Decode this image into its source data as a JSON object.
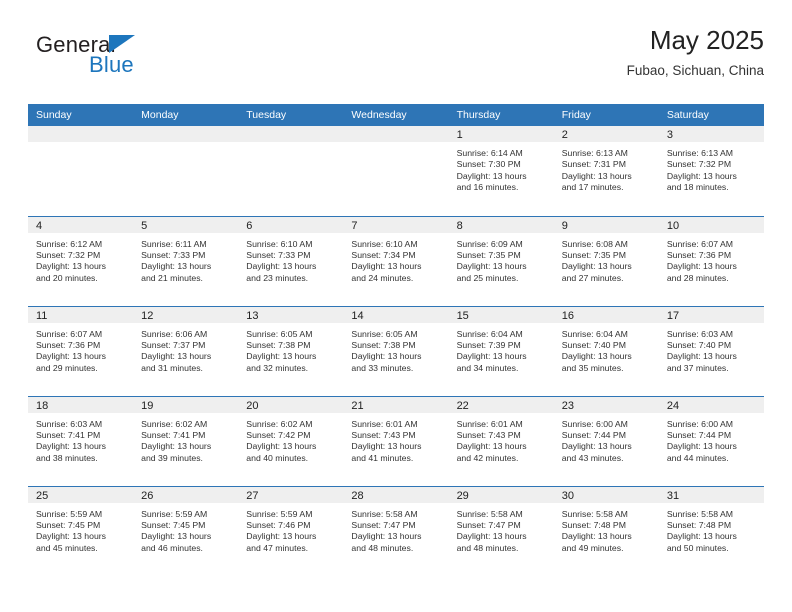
{
  "logo": {
    "word_top": "General",
    "word_bottom": "Blue",
    "flag_icon": "triangle-flag-icon",
    "color_blue": "#1d76bd",
    "color_dark": "#231f20"
  },
  "header": {
    "title": "May 2025",
    "subtitle": "Fubao, Sichuan, China"
  },
  "theme": {
    "header_blue": "#2e75b6",
    "date_strip_gray": "#efefef",
    "row_divider": "#2e75b6"
  },
  "weekdays": [
    "Sunday",
    "Monday",
    "Tuesday",
    "Wednesday",
    "Thursday",
    "Friday",
    "Saturday"
  ],
  "weeks": [
    [
      {
        "date": "",
        "lines": []
      },
      {
        "date": "",
        "lines": []
      },
      {
        "date": "",
        "lines": []
      },
      {
        "date": "",
        "lines": []
      },
      {
        "date": "1",
        "lines": [
          "Sunrise: 6:14 AM",
          "Sunset: 7:30 PM",
          "Daylight: 13 hours",
          "and 16 minutes."
        ]
      },
      {
        "date": "2",
        "lines": [
          "Sunrise: 6:13 AM",
          "Sunset: 7:31 PM",
          "Daylight: 13 hours",
          "and 17 minutes."
        ]
      },
      {
        "date": "3",
        "lines": [
          "Sunrise: 6:13 AM",
          "Sunset: 7:32 PM",
          "Daylight: 13 hours",
          "and 18 minutes."
        ]
      }
    ],
    [
      {
        "date": "4",
        "lines": [
          "Sunrise: 6:12 AM",
          "Sunset: 7:32 PM",
          "Daylight: 13 hours",
          "and 20 minutes."
        ]
      },
      {
        "date": "5",
        "lines": [
          "Sunrise: 6:11 AM",
          "Sunset: 7:33 PM",
          "Daylight: 13 hours",
          "and 21 minutes."
        ]
      },
      {
        "date": "6",
        "lines": [
          "Sunrise: 6:10 AM",
          "Sunset: 7:33 PM",
          "Daylight: 13 hours",
          "and 23 minutes."
        ]
      },
      {
        "date": "7",
        "lines": [
          "Sunrise: 6:10 AM",
          "Sunset: 7:34 PM",
          "Daylight: 13 hours",
          "and 24 minutes."
        ]
      },
      {
        "date": "8",
        "lines": [
          "Sunrise: 6:09 AM",
          "Sunset: 7:35 PM",
          "Daylight: 13 hours",
          "and 25 minutes."
        ]
      },
      {
        "date": "9",
        "lines": [
          "Sunrise: 6:08 AM",
          "Sunset: 7:35 PM",
          "Daylight: 13 hours",
          "and 27 minutes."
        ]
      },
      {
        "date": "10",
        "lines": [
          "Sunrise: 6:07 AM",
          "Sunset: 7:36 PM",
          "Daylight: 13 hours",
          "and 28 minutes."
        ]
      }
    ],
    [
      {
        "date": "11",
        "lines": [
          "Sunrise: 6:07 AM",
          "Sunset: 7:36 PM",
          "Daylight: 13 hours",
          "and 29 minutes."
        ]
      },
      {
        "date": "12",
        "lines": [
          "Sunrise: 6:06 AM",
          "Sunset: 7:37 PM",
          "Daylight: 13 hours",
          "and 31 minutes."
        ]
      },
      {
        "date": "13",
        "lines": [
          "Sunrise: 6:05 AM",
          "Sunset: 7:38 PM",
          "Daylight: 13 hours",
          "and 32 minutes."
        ]
      },
      {
        "date": "14",
        "lines": [
          "Sunrise: 6:05 AM",
          "Sunset: 7:38 PM",
          "Daylight: 13 hours",
          "and 33 minutes."
        ]
      },
      {
        "date": "15",
        "lines": [
          "Sunrise: 6:04 AM",
          "Sunset: 7:39 PM",
          "Daylight: 13 hours",
          "and 34 minutes."
        ]
      },
      {
        "date": "16",
        "lines": [
          "Sunrise: 6:04 AM",
          "Sunset: 7:40 PM",
          "Daylight: 13 hours",
          "and 35 minutes."
        ]
      },
      {
        "date": "17",
        "lines": [
          "Sunrise: 6:03 AM",
          "Sunset: 7:40 PM",
          "Daylight: 13 hours",
          "and 37 minutes."
        ]
      }
    ],
    [
      {
        "date": "18",
        "lines": [
          "Sunrise: 6:03 AM",
          "Sunset: 7:41 PM",
          "Daylight: 13 hours",
          "and 38 minutes."
        ]
      },
      {
        "date": "19",
        "lines": [
          "Sunrise: 6:02 AM",
          "Sunset: 7:41 PM",
          "Daylight: 13 hours",
          "and 39 minutes."
        ]
      },
      {
        "date": "20",
        "lines": [
          "Sunrise: 6:02 AM",
          "Sunset: 7:42 PM",
          "Daylight: 13 hours",
          "and 40 minutes."
        ]
      },
      {
        "date": "21",
        "lines": [
          "Sunrise: 6:01 AM",
          "Sunset: 7:43 PM",
          "Daylight: 13 hours",
          "and 41 minutes."
        ]
      },
      {
        "date": "22",
        "lines": [
          "Sunrise: 6:01 AM",
          "Sunset: 7:43 PM",
          "Daylight: 13 hours",
          "and 42 minutes."
        ]
      },
      {
        "date": "23",
        "lines": [
          "Sunrise: 6:00 AM",
          "Sunset: 7:44 PM",
          "Daylight: 13 hours",
          "and 43 minutes."
        ]
      },
      {
        "date": "24",
        "lines": [
          "Sunrise: 6:00 AM",
          "Sunset: 7:44 PM",
          "Daylight: 13 hours",
          "and 44 minutes."
        ]
      }
    ],
    [
      {
        "date": "25",
        "lines": [
          "Sunrise: 5:59 AM",
          "Sunset: 7:45 PM",
          "Daylight: 13 hours",
          "and 45 minutes."
        ]
      },
      {
        "date": "26",
        "lines": [
          "Sunrise: 5:59 AM",
          "Sunset: 7:45 PM",
          "Daylight: 13 hours",
          "and 46 minutes."
        ]
      },
      {
        "date": "27",
        "lines": [
          "Sunrise: 5:59 AM",
          "Sunset: 7:46 PM",
          "Daylight: 13 hours",
          "and 47 minutes."
        ]
      },
      {
        "date": "28",
        "lines": [
          "Sunrise: 5:58 AM",
          "Sunset: 7:47 PM",
          "Daylight: 13 hours",
          "and 48 minutes."
        ]
      },
      {
        "date": "29",
        "lines": [
          "Sunrise: 5:58 AM",
          "Sunset: 7:47 PM",
          "Daylight: 13 hours",
          "and 48 minutes."
        ]
      },
      {
        "date": "30",
        "lines": [
          "Sunrise: 5:58 AM",
          "Sunset: 7:48 PM",
          "Daylight: 13 hours",
          "and 49 minutes."
        ]
      },
      {
        "date": "31",
        "lines": [
          "Sunrise: 5:58 AM",
          "Sunset: 7:48 PM",
          "Daylight: 13 hours",
          "and 50 minutes."
        ]
      }
    ]
  ]
}
